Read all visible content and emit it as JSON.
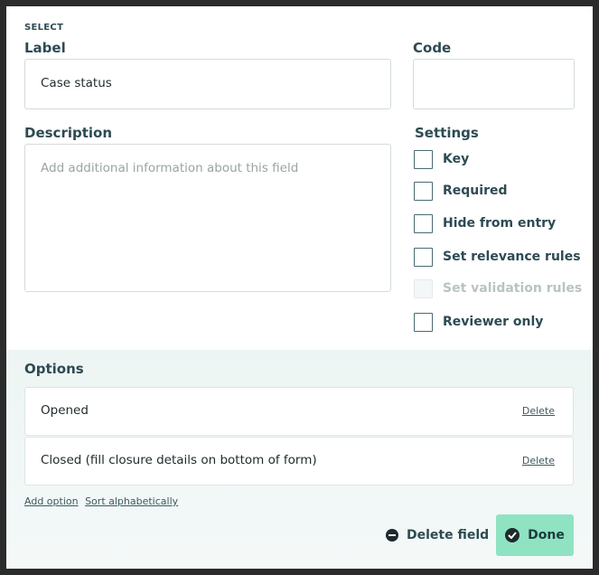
{
  "field_type": "SELECT",
  "label": {
    "heading": "Label",
    "value": "Case status"
  },
  "code": {
    "heading": "Code",
    "value": ""
  },
  "description": {
    "heading": "Description",
    "placeholder": "Add additional information about this field"
  },
  "settings": {
    "heading": "Settings",
    "items": [
      {
        "label": "Key",
        "checked": false,
        "disabled": false
      },
      {
        "label": "Required",
        "checked": false,
        "disabled": false
      },
      {
        "label": "Hide from entry",
        "checked": false,
        "disabled": false
      },
      {
        "label": "Set relevance rules",
        "checked": false,
        "disabled": false
      },
      {
        "label": "Set validation rules",
        "checked": false,
        "disabled": true
      },
      {
        "label": "Reviewer only",
        "checked": false,
        "disabled": false
      }
    ]
  },
  "options": {
    "heading": "Options",
    "items": [
      {
        "text": "Opened",
        "delete_label": "Delete"
      },
      {
        "text": "Closed (fill closure details on bottom of form)",
        "delete_label": "Delete"
      }
    ],
    "add_option_label": "Add option",
    "sort_label": "Sort alphabetically"
  },
  "actions": {
    "delete_field_label": "Delete field",
    "done_label": "Done"
  },
  "colors": {
    "done_bg": "#8fe3c2",
    "panel_bg": "#edf5f4",
    "text": "#2d4b52"
  }
}
